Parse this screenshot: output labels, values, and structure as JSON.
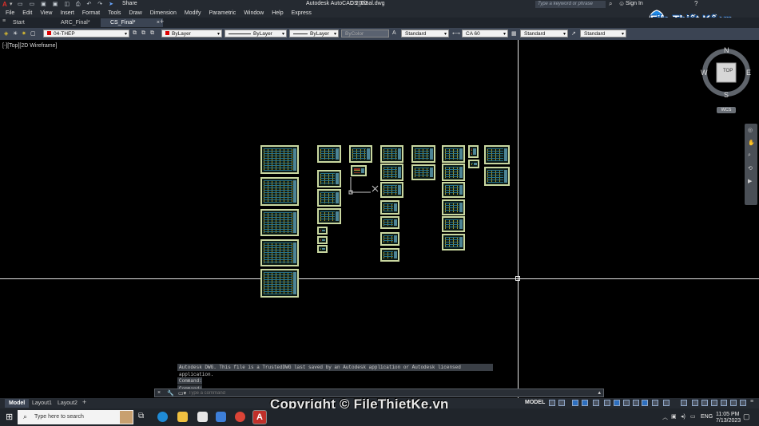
{
  "title_bar": {
    "app_title": "Autodesk AutoCAD 2022",
    "file_name": "CS_Final.dwg",
    "share_label": "Share",
    "search_placeholder": "Type a keyword or phrase",
    "sign_in": "Sign In"
  },
  "menu": [
    "File",
    "Edit",
    "View",
    "Insert",
    "Format",
    "Tools",
    "Draw",
    "Dimension",
    "Modify",
    "Parametric",
    "Window",
    "Help",
    "Express"
  ],
  "doc_tabs": [
    {
      "label": "Start"
    },
    {
      "label": "ARC_Final*"
    },
    {
      "label": "CS_Final*"
    }
  ],
  "properties": {
    "layer": "04-THEP",
    "color": "ByLayer",
    "linetype": "ByLayer",
    "lineweight": "ByLayer",
    "plot_style": "ByColor",
    "text_style": "Standard",
    "dim_style": "CA 60",
    "table_style": "Standard",
    "mleader_style": "Standard"
  },
  "viewport_label": "[-][Top][2D Wireframe]",
  "viewcube": {
    "top": "TOP",
    "n": "N",
    "s": "S",
    "e": "E",
    "w": "W",
    "wcs": "WCS"
  },
  "command_history": [
    "Autodesk DWG.  This file is a TrustedDWG last saved by an Autodesk application or Autodesk licensed application.",
    "Command:",
    "Command:"
  ],
  "command_placeholder": "Type a command",
  "layout_tabs": [
    "Model",
    "Layout1",
    "Layout2"
  ],
  "status": {
    "model": "MODEL"
  },
  "taskbar": {
    "search_placeholder": "Type here to search",
    "lang": "ENG",
    "time": "11:05 PM",
    "date": "7/13/2023"
  },
  "watermark": "Copyright © FileThietKe.vn",
  "logo_text": "File Thiết Kế.vn",
  "colors": {
    "accent": "#3b4453",
    "titlebar": "#252a31",
    "sheet_border": "#c9d7a0"
  }
}
